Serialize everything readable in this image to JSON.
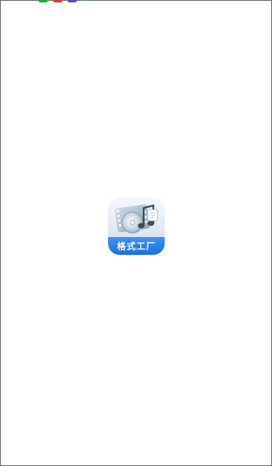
{
  "status_bar": {
    "icons": [
      {
        "name": "notification-green-icon",
        "color": "#2f9d48"
      },
      {
        "name": "notification-red-icon",
        "color": "#d83a3a"
      },
      {
        "name": "notification-purple-icon",
        "color": "#5a4fb0"
      },
      {
        "name": "notification-cyan-icon",
        "color": "#27a7d8"
      }
    ]
  },
  "splash": {
    "app_name": "格式工厂",
    "band_color": "#2a82ea"
  }
}
